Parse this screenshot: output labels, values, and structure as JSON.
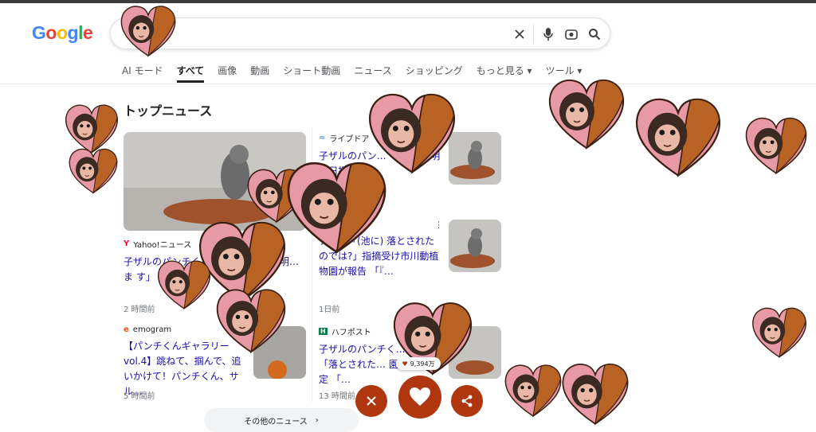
{
  "logo": [
    "G",
    "o",
    "o",
    "g",
    "l",
    "e"
  ],
  "search": {
    "value": "",
    "placeholder": ""
  },
  "tabs": [
    "AI モード",
    "すべて",
    "画像",
    "動画",
    "ショート動画",
    "ニュース",
    "ショッピング",
    "もっと見る ▾",
    "ツール ▾"
  ],
  "section_title": "トップニュース",
  "news": [
    {
      "source": "Yahoo!ニュース",
      "headline": "子ザルのパンチくん 状態について説明… ま す」 近況",
      "time": "2 時間前"
    },
    {
      "source": "ライブドア",
      "headline": "子ザルのパン… てい… 説明 (9日掲載)",
      "time": ""
    },
    {
      "source": "",
      "headline": "チくん「(池に) 落とされたのでは?」指摘受け市川動植物園が報告 「『…",
      "time": "1日前"
    },
    {
      "source": "emogram",
      "headline": "【パンチくんギャラリー vol.4】跳ねて、掴んで、追いかけて！パンチくん、サル…",
      "time": "5 時間前"
    },
    {
      "source": "ハフポスト",
      "headline": "子ザルのパンチく… 下⇨「落とされた… 園が個体特定 「…",
      "time": "13 時間前"
    }
  ],
  "more_news": "その他のニュース",
  "like_count": "9,394万",
  "colors": {
    "accent": "#b0360f",
    "link": "#1a0dab"
  },
  "icons": [
    "clear-icon",
    "mic-icon",
    "lens-icon",
    "search-icon",
    "close-icon",
    "heart-icon",
    "share-icon"
  ]
}
